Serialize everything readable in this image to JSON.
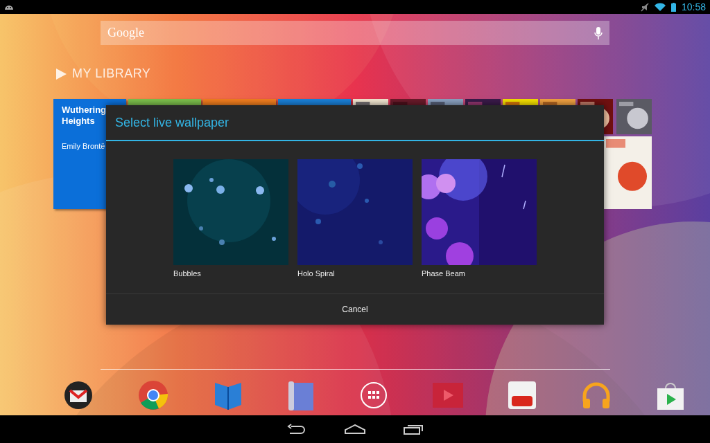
{
  "status_bar": {
    "time": "10:58"
  },
  "search": {
    "logo": "Google"
  },
  "library": {
    "title": "MY LIBRARY",
    "tiles": [
      {
        "kind": "book",
        "title": "Wuthering Heights",
        "author": "Emily Brontë",
        "color": "#0b6fd9"
      },
      {
        "kind": "book",
        "color": "#7cbf4c"
      },
      {
        "kind": "book",
        "color": "#f07d1e"
      },
      {
        "kind": "book",
        "color": "#1a80d8"
      },
      {
        "kind": "picture"
      },
      {
        "kind": "picture"
      },
      {
        "kind": "picture"
      },
      {
        "kind": "picture"
      },
      {
        "kind": "picture"
      },
      {
        "kind": "picture"
      },
      {
        "kind": "picture"
      },
      {
        "kind": "picture"
      },
      {
        "kind": "picture"
      }
    ]
  },
  "dialog": {
    "title": "Select live wallpaper",
    "wallpapers": [
      {
        "name": "Bubbles",
        "kind": "bubbles"
      },
      {
        "name": "Holo Spiral",
        "kind": "spiral"
      },
      {
        "name": "Phase Beam",
        "kind": "beam"
      }
    ],
    "button": "Cancel"
  }
}
